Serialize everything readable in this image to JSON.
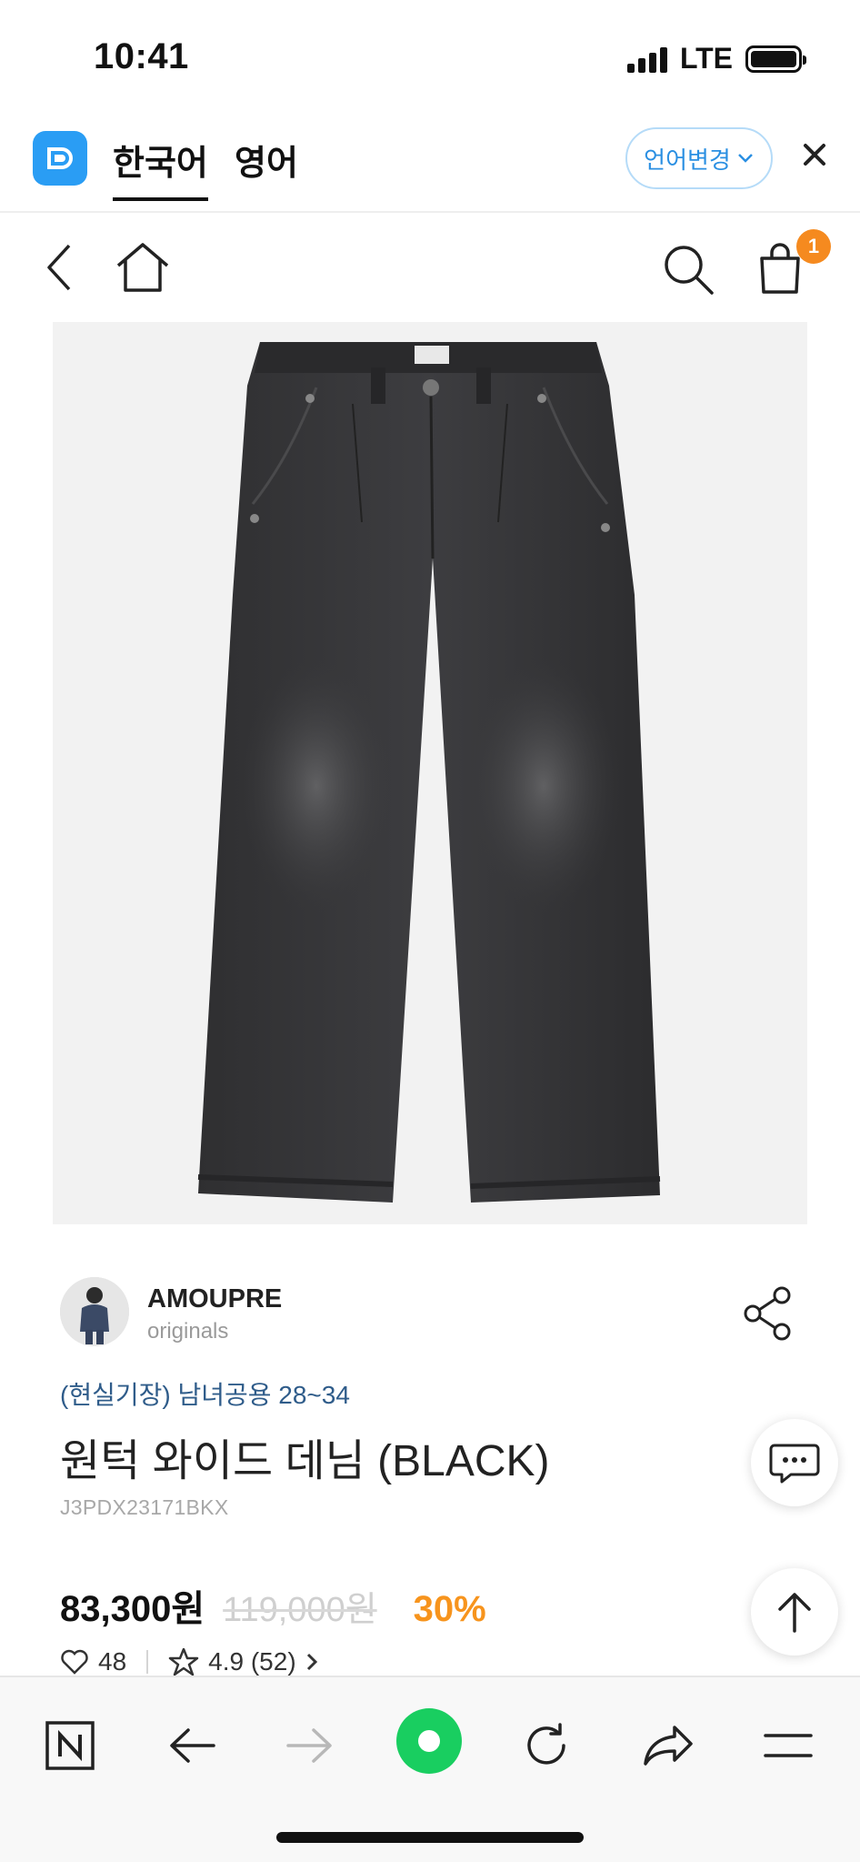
{
  "status_bar": {
    "time": "10:41",
    "network": "LTE"
  },
  "translate_bar": {
    "tabs": [
      {
        "label": "한국어",
        "active": true
      },
      {
        "label": "영어",
        "active": false
      }
    ],
    "language_button": "언어변경",
    "close_icon": "close-icon",
    "accent_color": "#2a9df4"
  },
  "site_nav": {
    "cart_count": "1",
    "badge_color": "#f58a1f"
  },
  "product": {
    "brand": {
      "name": "AMOUPRE",
      "sub": "originals"
    },
    "subtitle": "(현실기장) 남녀공용 28~34",
    "title": "원턱 와이드 데님 (BLACK)",
    "code": "J3PDX23171BKX",
    "price": "83,300원",
    "original_price": "119,000원",
    "discount": "30%",
    "discount_color": "#f7941d",
    "likes": "48",
    "rating": "4.9 (52)"
  },
  "browser_bar": {
    "items": [
      "naver-home-icon",
      "back-arrow-icon",
      "forward-arrow-icon",
      "green-dot-icon",
      "refresh-icon",
      "share-icon",
      "menu-icon"
    ],
    "accent_color": "#19ce60"
  }
}
